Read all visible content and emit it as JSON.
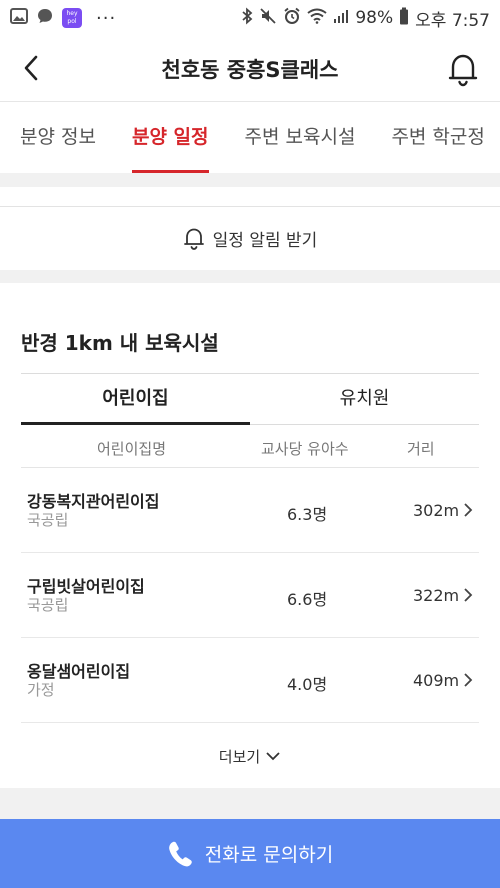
{
  "status_bar": {
    "app_badge_text": "hey pol",
    "dots": "···",
    "battery": "98%",
    "time": "오후 7:57"
  },
  "header": {
    "title": "천호동 중흥S클래스"
  },
  "tabs": [
    {
      "label": "분양 정보",
      "active": false
    },
    {
      "label": "분양 일정",
      "active": true
    },
    {
      "label": "주변 보육시설",
      "active": false
    },
    {
      "label": "주변 학군정",
      "active": false
    }
  ],
  "alarm": {
    "label": "일정 알림 받기"
  },
  "section": {
    "title": "반경 1km 내 보육시설",
    "subtabs": [
      {
        "label": "어린이집",
        "active": true
      },
      {
        "label": "유치원",
        "active": false
      }
    ],
    "columns": [
      "어린이집명",
      "교사당 유아수",
      "거리"
    ],
    "rows": [
      {
        "name": "강동복지관어린이집",
        "type": "국공립",
        "ratio": "6.3명",
        "distance": "302m"
      },
      {
        "name": "구립빗살어린이집",
        "type": "국공립",
        "ratio": "6.6명",
        "distance": "322m"
      },
      {
        "name": "옹달샘어린이집",
        "type": "가정",
        "ratio": "4.0명",
        "distance": "409m"
      }
    ],
    "more_label": "더보기"
  },
  "call_button": {
    "label": "전화로 문의하기"
  },
  "colors": {
    "accent_red": "#d6262b",
    "call_blue": "#5a88f0"
  }
}
